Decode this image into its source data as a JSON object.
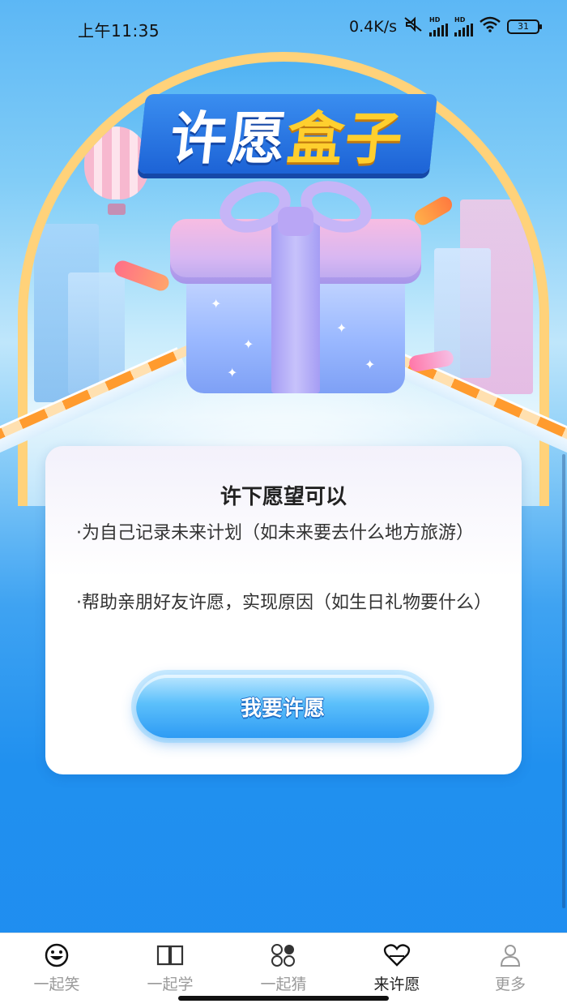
{
  "status_bar": {
    "time": "上午11:35",
    "network_speed": "0.4K/s",
    "signal_1_tag": "HD",
    "signal_2_tag": "HD",
    "battery": "31",
    "icons": [
      "mute-icon",
      "signal-icon",
      "signal-icon",
      "wifi-icon",
      "battery-icon"
    ]
  },
  "hero": {
    "title_part1": "许愿",
    "title_part2": "盒子"
  },
  "card": {
    "title": "许下愿望可以",
    "line1": "·为自己记录未来计划（如未来要去什么地方旅游）",
    "line2": "·帮助亲朋好友许愿，实现原因（如生日礼物要什么）",
    "button_label": "我要许愿"
  },
  "bottom_nav": {
    "items": [
      {
        "label": "一起笑",
        "icon": "smiley-icon",
        "active": false
      },
      {
        "label": "一起学",
        "icon": "book-icon",
        "active": false
      },
      {
        "label": "一起猜",
        "icon": "circles-icon",
        "active": false
      },
      {
        "label": "来许愿",
        "icon": "heart-icon",
        "active": true
      },
      {
        "label": "更多",
        "icon": "user-icon",
        "active": false
      }
    ]
  },
  "colors": {
    "background_blue": "#1f8df0",
    "arch_gold": "#ffd27a",
    "button_blue": "#2e9bf4",
    "title_yellow": "#ffcf2e",
    "nav_inactive": "#9a9a9a",
    "nav_active": "#222222"
  }
}
